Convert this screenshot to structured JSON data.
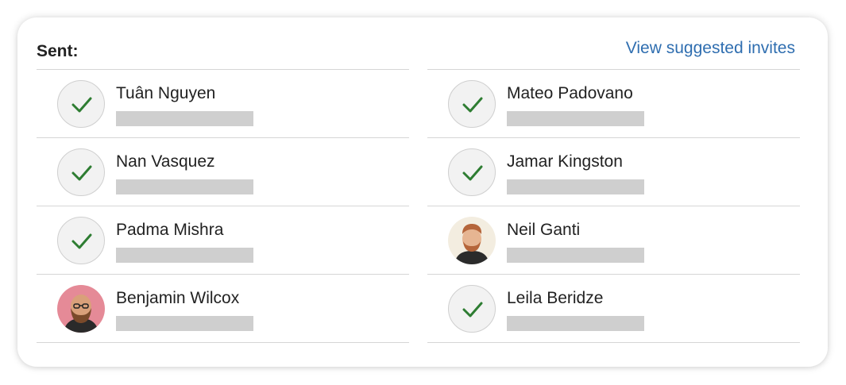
{
  "header": {
    "sent_label": "Sent:",
    "view_suggested_label": "View suggested invites"
  },
  "colors": {
    "link": "#2f6eb0",
    "check": "#2e7d32",
    "placeholder_bar": "#cfcfcf"
  },
  "left": {
    "rows": [
      {
        "name": "Tuân Nguyen",
        "avatar": "check-icon"
      },
      {
        "name": "Nan Vasquez",
        "avatar": "check-icon"
      },
      {
        "name": "Padma Mishra",
        "avatar": "check-icon"
      },
      {
        "name": "Benjamin Wilcox",
        "avatar": "photo"
      }
    ]
  },
  "right": {
    "rows": [
      {
        "name": "Mateo Padovano",
        "avatar": "check-icon"
      },
      {
        "name": "Jamar Kingston",
        "avatar": "check-icon"
      },
      {
        "name": "Neil Ganti",
        "avatar": "photo"
      },
      {
        "name": "Leila Beridze",
        "avatar": "check-icon"
      }
    ]
  }
}
